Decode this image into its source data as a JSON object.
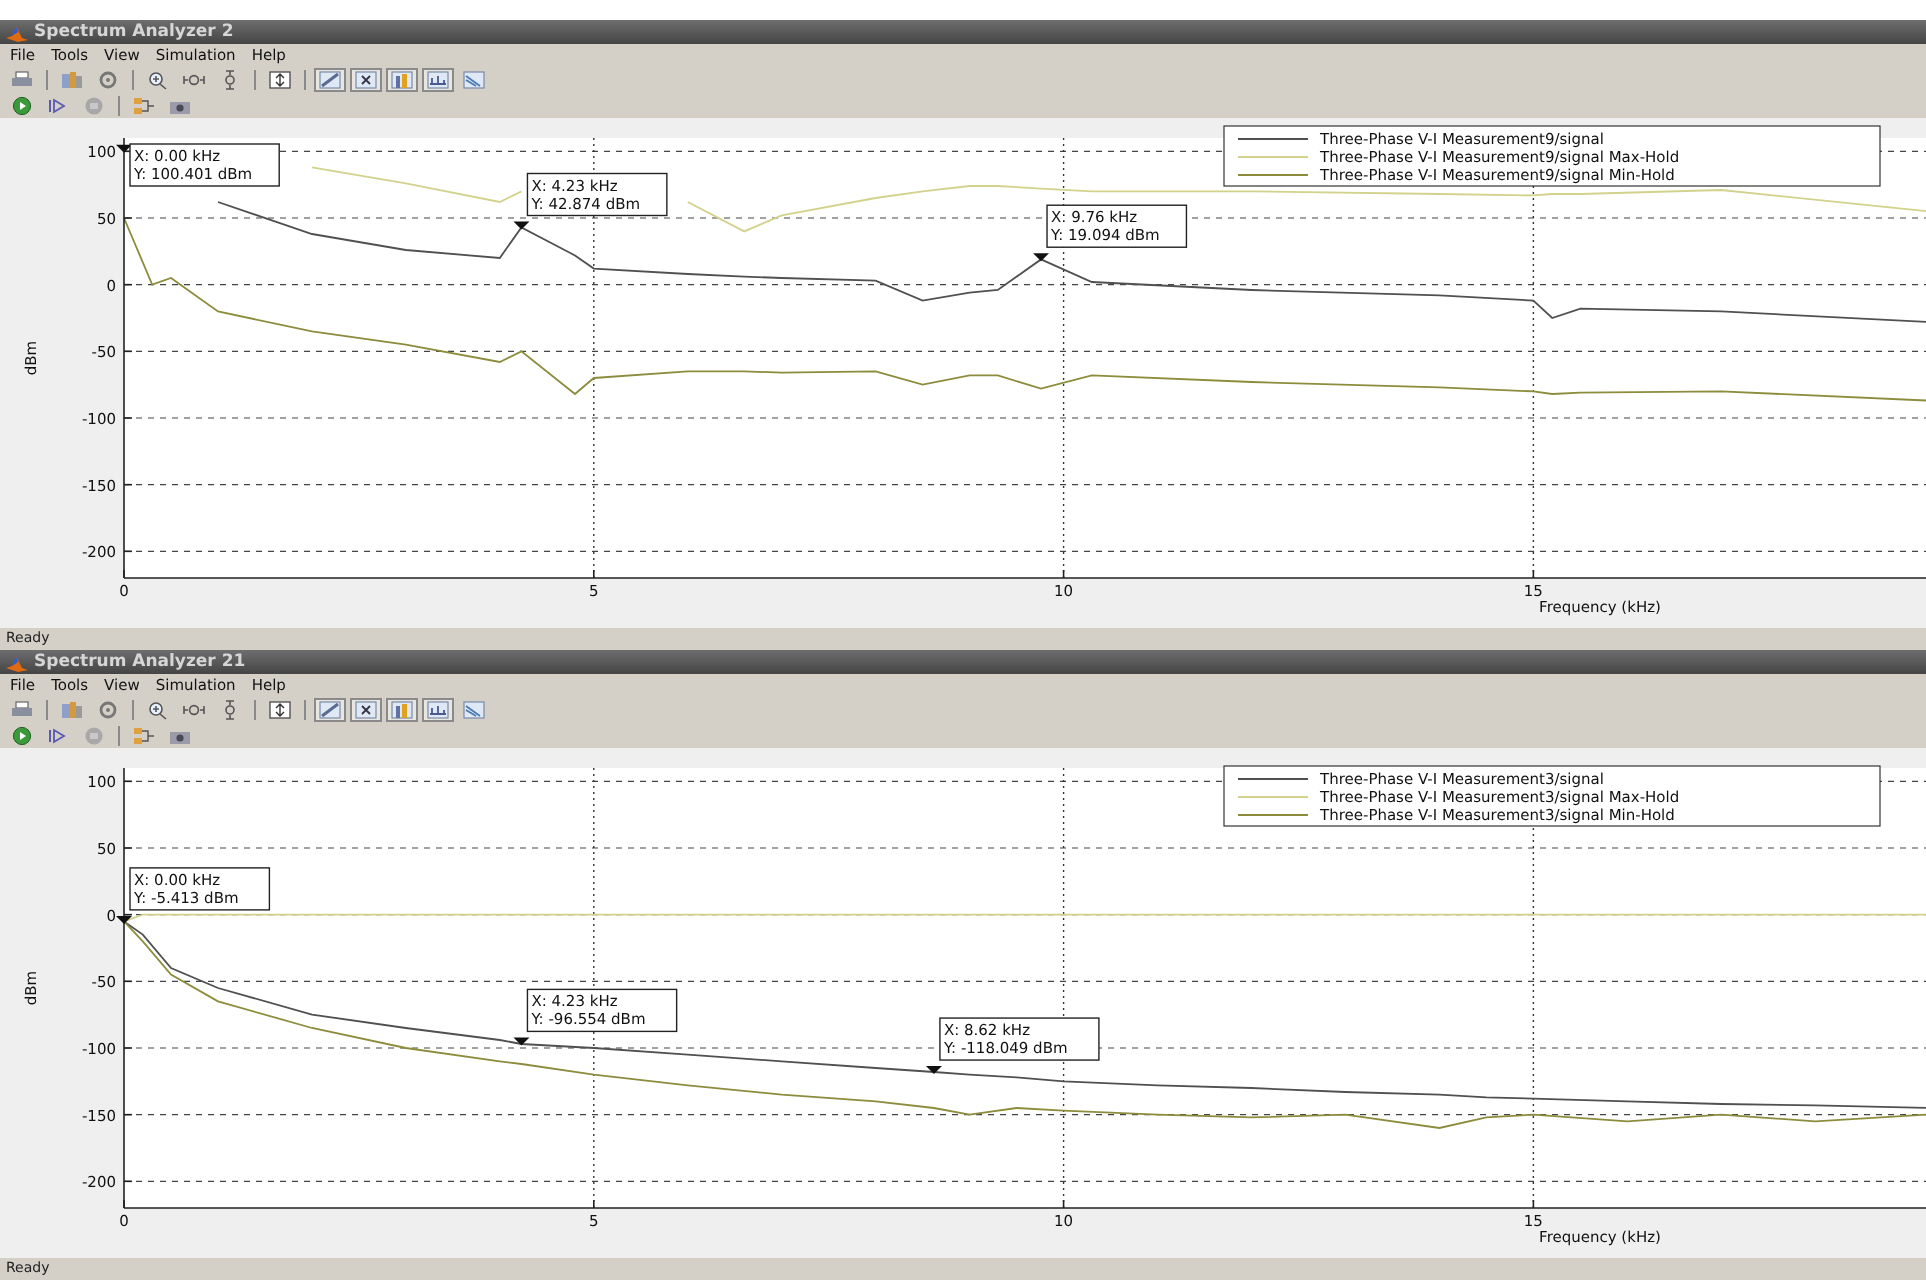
{
  "windows": [
    {
      "title": "Spectrum Analyzer 2",
      "menu": [
        "File",
        "Tools",
        "View",
        "Simulation",
        "Help"
      ],
      "plot": {
        "chart_data": {
          "type": "line",
          "xlabel": "Frequency (kHz)",
          "ylabel": "dBm",
          "xlim": [
            0,
            19.2
          ],
          "ylim": [
            -220,
            110
          ],
          "xticks": [
            0,
            5,
            10,
            15
          ],
          "yticks": [
            100,
            50,
            0,
            -50,
            -100,
            -150,
            -200
          ],
          "grid": true,
          "legend": true,
          "x": [
            0,
            0.3,
            0.5,
            1,
            2,
            3,
            4,
            4.23,
            4.8,
            5,
            6,
            6.6,
            7,
            8,
            8.5,
            9,
            9.3,
            9.76,
            10.3,
            12,
            14,
            15,
            15.2,
            15.5,
            17,
            19.2
          ],
          "series": [
            {
              "name": "Three-Phase V-I Measurement9/signal",
              "color": "#505050",
              "values": [
                null,
                null,
                null,
                62,
                38,
                26,
                20,
                43,
                22,
                12,
                8,
                6,
                5,
                3,
                -12,
                -6,
                -4,
                19,
                2,
                -4,
                -8,
                -12,
                -25,
                -18,
                -20,
                -28
              ]
            },
            {
              "name": "Three-Phase V-I Measurement9/signal Max-Hold",
              "color": "#d2d28c",
              "values": [
                null,
                null,
                null,
                null,
                88,
                76,
                62,
                70,
                null,
                null,
                62,
                40,
                52,
                65,
                70,
                74,
                74,
                72,
                70,
                70,
                68,
                67,
                68,
                68,
                71,
                55
              ]
            },
            {
              "name": "Three-Phase V-I Measurement9/signal Min-Hold",
              "color": "#8c8c3c",
              "values": [
                50,
                0,
                5,
                -20,
                -35,
                -45,
                -58,
                -50,
                -82,
                -70,
                -65,
                -65,
                -66,
                -65,
                -75,
                -68,
                -68,
                -78,
                -68,
                -73,
                -77,
                -80,
                -82,
                -81,
                -80,
                -87
              ]
            }
          ],
          "annotations": [
            {
              "x": 0,
              "y": 100.401,
              "text": "X: 0.00 kHz\nY: 100.401 dBm"
            },
            {
              "x": 4.23,
              "y": 42.874,
              "text": "X: 4.23 kHz\nY: 42.874 dBm"
            },
            {
              "x": 9.76,
              "y": 19.094,
              "text": "X: 9.76 kHz\nY: 19.094 dBm"
            }
          ]
        }
      },
      "status_bar": "Ready"
    },
    {
      "title": "Spectrum Analyzer 21",
      "menu": [
        "File",
        "Tools",
        "View",
        "Simulation",
        "Help"
      ],
      "plot": {
        "chart_data": {
          "type": "line",
          "xlabel": "Frequency (kHz)",
          "ylabel": "dBm",
          "xlim": [
            0,
            19.2
          ],
          "ylim": [
            -220,
            110
          ],
          "xticks": [
            0,
            5,
            10,
            15
          ],
          "yticks": [
            100,
            50,
            0,
            -50,
            -100,
            -150,
            -200
          ],
          "grid": true,
          "legend": true,
          "x": [
            0,
            0.2,
            0.5,
            1,
            2,
            3,
            4,
            4.23,
            5,
            6,
            7,
            8,
            8.62,
            9,
            9.5,
            10,
            11,
            12,
            13,
            14,
            14.5,
            15,
            16,
            17,
            18,
            19.2
          ],
          "series": [
            {
              "name": "Three-Phase V-I Measurement3/signal",
              "color": "#505050",
              "values": [
                -5,
                -15,
                -40,
                -55,
                -75,
                -85,
                -94,
                -97,
                -100,
                -105,
                -110,
                -115,
                -118,
                -120,
                -122,
                -125,
                -128,
                -130,
                -133,
                -135,
                -137,
                -138,
                -140,
                -142,
                -143,
                -145
              ]
            },
            {
              "name": "Three-Phase V-I Measurement3/signal Max-Hold",
              "color": "#d2d28c",
              "values": [
                -5,
                0,
                0,
                0,
                0,
                0,
                0,
                0,
                0,
                0,
                0,
                0,
                0,
                0,
                0,
                0,
                0,
                0,
                0,
                0,
                0,
                0,
                0,
                0,
                0,
                0
              ]
            },
            {
              "name": "Three-Phase V-I Measurement3/signal Min-Hold",
              "color": "#8c8c3c",
              "values": [
                -5,
                -20,
                -45,
                -65,
                -85,
                -100,
                -110,
                -112,
                -120,
                -128,
                -135,
                -140,
                -145,
                -150,
                -145,
                -147,
                -150,
                -152,
                -150,
                -160,
                -152,
                -150,
                -155,
                -150,
                -155,
                -150
              ]
            }
          ],
          "annotations": [
            {
              "x": 0,
              "y": -5.413,
              "text": "X: 0.00 kHz\nY: -5.413 dBm"
            },
            {
              "x": 4.23,
              "y": -96.554,
              "text": "X: 4.23 kHz\nY: -96.554 dBm"
            },
            {
              "x": 8.62,
              "y": -118.049,
              "text": "X: 8.62 kHz\nY: -118.049 dBm"
            }
          ]
        }
      },
      "status_bar": "Ready"
    }
  ]
}
